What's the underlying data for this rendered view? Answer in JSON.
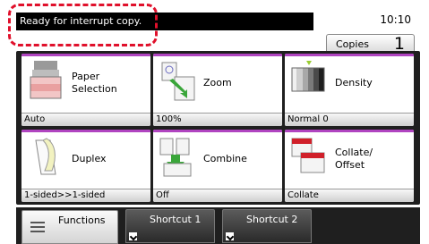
{
  "status": {
    "message": "Ready for interrupt copy.",
    "time": "10:10"
  },
  "copies": {
    "label": "Copies",
    "count": "1"
  },
  "tiles": [
    {
      "label": "Paper\nSelection",
      "value": "Auto"
    },
    {
      "label": "Zoom",
      "value": "100%"
    },
    {
      "label": "Density",
      "value": "Normal 0"
    },
    {
      "label": "Duplex",
      "value": "1-sided>>1-sided"
    },
    {
      "label": "Combine",
      "value": "Off"
    },
    {
      "label": "Collate/\nOffset",
      "value": "Collate"
    }
  ],
  "tabs": {
    "functions": "Functions",
    "shortcut1": "Shortcut 1",
    "shortcut2": "Shortcut 2"
  },
  "colors": {
    "accent": "#b044c0",
    "panel": "#1f1f1f",
    "highlight": "#e0102b"
  }
}
